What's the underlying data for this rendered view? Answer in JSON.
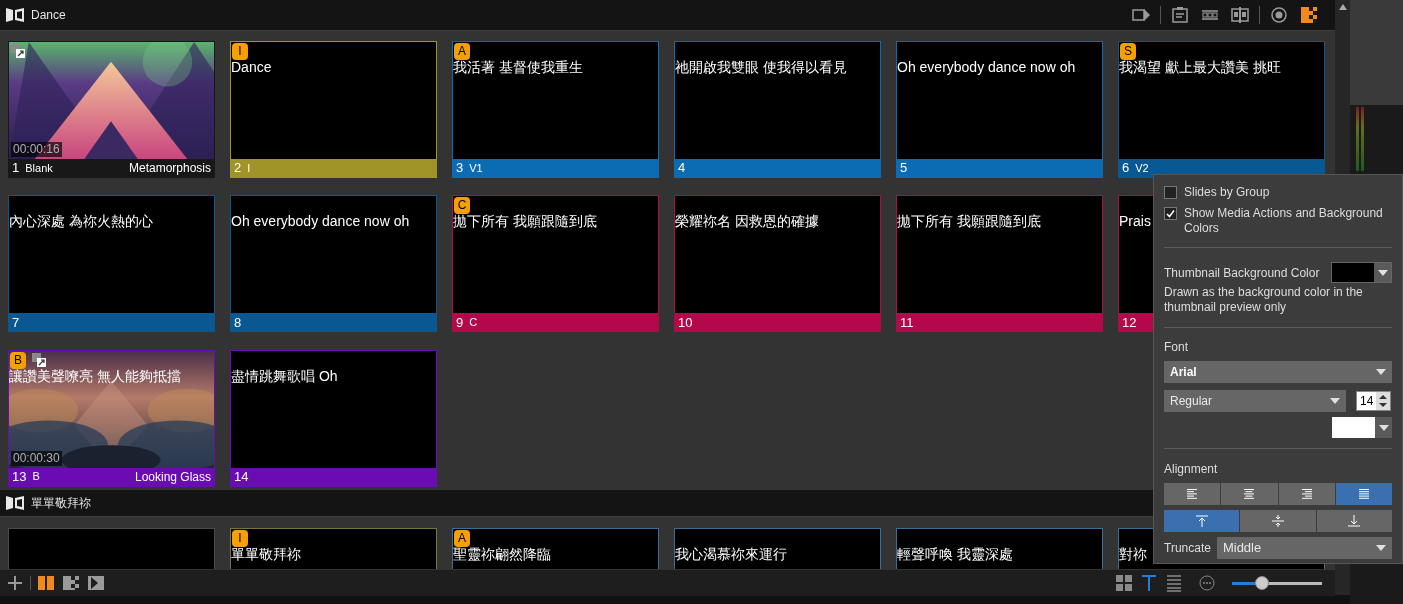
{
  "header_tools": [
    {
      "kind": "play-out",
      "active": false
    },
    {
      "kind": "clipboard",
      "active": false
    },
    {
      "kind": "cycle",
      "active": false
    },
    {
      "kind": "split",
      "active": false
    },
    {
      "kind": "target",
      "active": false
    },
    {
      "kind": "checker",
      "active": true
    }
  ],
  "groups": [
    {
      "title": "Dance",
      "slides": [
        {
          "kind": "media",
          "number": "1",
          "label": "Blank",
          "media_name": "Metamorphosis",
          "timecode": "00:00:16",
          "color": "#181818"
        },
        {
          "kind": "text",
          "number": "2",
          "label": "I",
          "badge": "I",
          "text": "Dance",
          "color": "#a09429"
        },
        {
          "kind": "text",
          "number": "3",
          "label": "V1",
          "badge": "A",
          "text": "我活著 基督使我重生",
          "color": "#0b6cb4"
        },
        {
          "kind": "text",
          "number": "4",
          "text": "祂開啟我雙眼 使我得以看見",
          "color": "#0b6cb4"
        },
        {
          "kind": "text",
          "number": "5",
          "text": "Oh everybody dance now oh",
          "color": "#0b6cb4"
        },
        {
          "kind": "text",
          "number": "6",
          "label": "V2",
          "badge": "S",
          "text": "我渴望 獻上最大讚美 挑旺",
          "color": "#0a5891"
        },
        {
          "kind": "text",
          "number": "7",
          "text": "內心深處  為祢火熱的心",
          "color": "#0a5891"
        },
        {
          "kind": "text",
          "number": "8",
          "text": "Oh everybody dance now oh",
          "color": "#0a5891"
        },
        {
          "kind": "text",
          "number": "9",
          "label": "C",
          "badge": "C",
          "text": "拋下所有  我願跟隨到底",
          "color": "#b3094a"
        },
        {
          "kind": "text",
          "number": "10",
          "text": "榮耀祢名 因救恩的確據",
          "color": "#b3094a"
        },
        {
          "kind": "text",
          "number": "11",
          "text": "拋下所有  我願跟隨到底",
          "color": "#b3094a"
        },
        {
          "kind": "text",
          "number": "12",
          "text": "Prais",
          "color": "#b3094a"
        },
        {
          "kind": "media",
          "number": "13",
          "label": "B",
          "badge": "B",
          "text": "讓讚美聲嘹亮 無人能夠抵擋",
          "media_name": "Looking Glass",
          "timecode": "00:00:30",
          "color": "#6b0bb3"
        },
        {
          "kind": "text",
          "number": "14",
          "text": "盡情跳舞歌唱 Oh",
          "color": "#6b0bb3"
        }
      ]
    },
    {
      "title": "單單敬拜祢",
      "slides": [
        {
          "kind": "text",
          "color": "#4a4a4a"
        },
        {
          "kind": "text",
          "badge": "I",
          "text": "單單敬拜祢",
          "color": "#7a7340"
        },
        {
          "kind": "text",
          "badge": "A",
          "text": "聖靈祢翩然降臨",
          "color": "#3b6e96"
        },
        {
          "kind": "text",
          "text": "我心渴慕祢來運行",
          "color": "#3b6e96"
        },
        {
          "kind": "text",
          "text": "輕聲呼喚 我靈深處",
          "color": "#3b6e96"
        },
        {
          "kind": "text",
          "text": "對祢",
          "color": "#3b6e96"
        }
      ]
    }
  ],
  "bottom_tools": [
    {
      "kind": "add"
    },
    {
      "kind": "columns",
      "active": true
    },
    {
      "kind": "checker"
    },
    {
      "kind": "arrow"
    }
  ],
  "view_buttons": [
    {
      "kind": "grid",
      "selected": false
    },
    {
      "kind": "text",
      "selected": true
    },
    {
      "kind": "list",
      "selected": false
    }
  ],
  "zoom_slider": {
    "level": 0.33
  },
  "settings": {
    "checkboxes": [
      {
        "label": "Slides by Group",
        "checked": false
      },
      {
        "label": "Show Media Actions and Background Colors",
        "checked": true
      }
    ],
    "thumbnail_background": {
      "label": "Thumbnail Background Color",
      "color": "#000000",
      "description": "Drawn as the background color in the thumbnail preview only"
    },
    "font": {
      "label": "Font",
      "family": "Arial",
      "style": "Regular",
      "size": "14",
      "color": "#ffffff"
    },
    "alignment": {
      "label": "Alignment",
      "horizontal": [
        {
          "kind": "left",
          "selected": false
        },
        {
          "kind": "center",
          "selected": false
        },
        {
          "kind": "right",
          "selected": false
        },
        {
          "kind": "justify",
          "selected": true
        }
      ],
      "vertical": [
        {
          "kind": "top",
          "selected": true
        },
        {
          "kind": "middle",
          "selected": false
        },
        {
          "kind": "bottom",
          "selected": false
        }
      ]
    },
    "truncate": {
      "label": "Truncate",
      "value": "Middle"
    }
  }
}
